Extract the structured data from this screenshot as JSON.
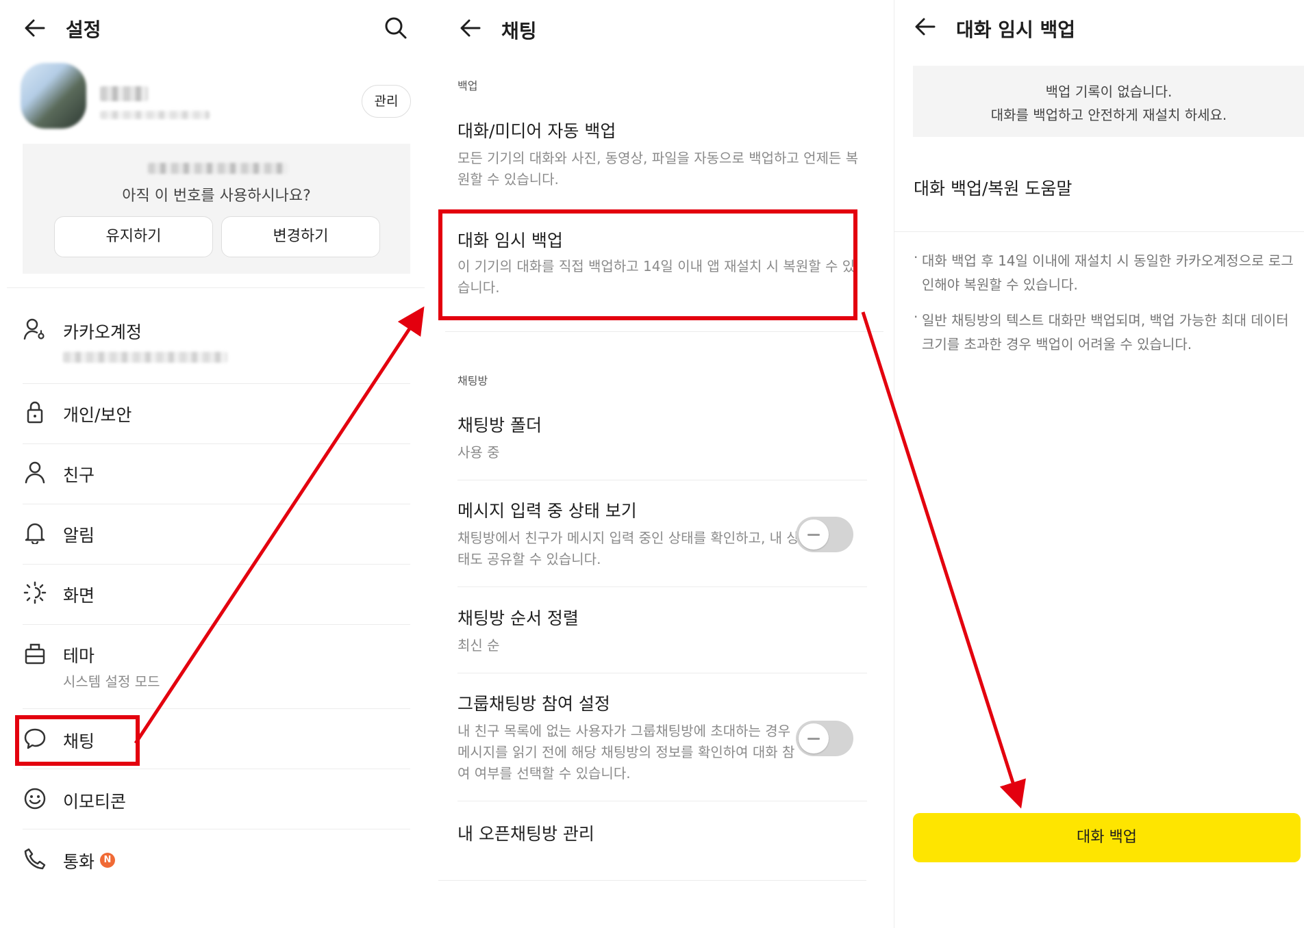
{
  "settings": {
    "title": "설정",
    "manage_label": "관리",
    "prompt": "아직 이 번호를 사용하시나요?",
    "keep_label": "유지하기",
    "change_label": "변경하기",
    "menu": [
      {
        "label": "카카오계정",
        "icon": "account-icon"
      },
      {
        "label": "개인/보안",
        "icon": "lock-icon"
      },
      {
        "label": "친구",
        "icon": "person-icon"
      },
      {
        "label": "알림",
        "icon": "bell-icon"
      },
      {
        "label": "화면",
        "icon": "brightness-icon"
      },
      {
        "label": "테마",
        "icon": "theme-icon",
        "sub": "시스템 설정 모드"
      },
      {
        "label": "채팅",
        "icon": "chat-bubble-icon"
      },
      {
        "label": "이모티콘",
        "icon": "emoticon-icon"
      },
      {
        "label": "통화",
        "icon": "phone-icon",
        "badge": "N"
      }
    ]
  },
  "chat": {
    "title": "채팅",
    "section_backup": "백업",
    "auto_backup": {
      "title": "대화/미디어 자동 백업",
      "desc": "모든 기기의 대화와 사진, 동영상, 파일을 자동으로 백업하고 언제든 복원할 수 있습니다."
    },
    "temp_backup": {
      "title": "대화 임시 백업",
      "desc": "이 기기의 대화를 직접 백업하고 14일 이내 앱 재설치 시 복원할 수 있습니다."
    },
    "section_room": "채팅방",
    "folder": {
      "title": "채팅방 폴더",
      "desc": "사용 중"
    },
    "typing": {
      "title": "메시지 입력 중 상태 보기",
      "desc": "채팅방에서 친구가 메시지 입력 중인 상태를 확인하고, 내 상태도 공유할 수 있습니다.",
      "enabled": false
    },
    "order": {
      "title": "채팅방 순서 정렬",
      "desc": "최신 순"
    },
    "group": {
      "title": "그룹채팅방 참여 설정",
      "desc": "내 친구 목록에 없는 사용자가 그룹채팅방에 초대하는 경우 메시지를 읽기 전에 해당 채팅방의 정보를 확인하여 대화 참여 여부를 선택할 수 있습니다.",
      "enabled": false
    },
    "open": {
      "title": "내 오픈채팅방 관리"
    }
  },
  "temp_backup_page": {
    "title": "대화 임시 백업",
    "empty_line1": "백업 기록이 없습니다.",
    "empty_line2": "대화를 백업하고 안전하게 재설치 하세요.",
    "help": "대화 백업/복원 도움말",
    "note1": "대화 백업 후 14일 이내에 재설치 시 동일한 카카오계정으로 로그인해야 복원할 수 있습니다.",
    "note2": "일반 채팅방의 텍스트 대화만 백업되며, 백업 가능한 최대 데이터 크기를 초과한 경우 백업이 어려울 수 있습니다.",
    "button": "대화 백업"
  },
  "colors": {
    "highlight": "#e3000e",
    "primary_button": "#fee500",
    "badge": "#f06a35"
  }
}
